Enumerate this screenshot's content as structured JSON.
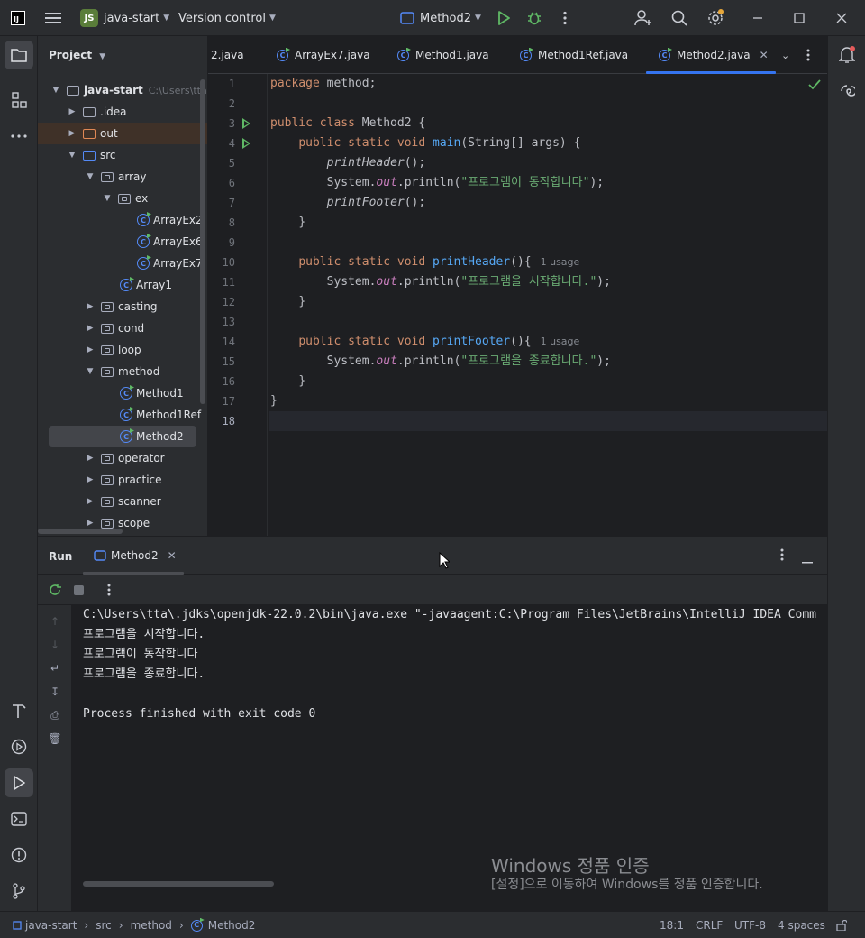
{
  "titlebar": {
    "project_name": "java-start",
    "project_badge": "JS",
    "vcs": "Version control",
    "run_config": "Method2"
  },
  "left_stripe": [
    "folder-icon",
    "structure-icon",
    "more-icon",
    "build-icon",
    "services-icon",
    "run-icon",
    "terminal-icon",
    "problems-icon",
    "git-icon"
  ],
  "right_stripe": [
    "notifications-icon",
    "ai-assistant-icon"
  ],
  "project_panel": {
    "title": "Project",
    "root": "java-start",
    "root_path": "C:\\Users\\tta",
    "tree": [
      {
        "label": ".idea",
        "type": "folder"
      },
      {
        "label": "out",
        "type": "out"
      },
      {
        "label": "src",
        "type": "src"
      },
      {
        "label": "array",
        "type": "pkg"
      },
      {
        "label": "ex",
        "type": "pkg"
      },
      {
        "label": "ArrayEx2",
        "type": "class"
      },
      {
        "label": "ArrayEx6",
        "type": "class"
      },
      {
        "label": "ArrayEx7",
        "type": "class"
      },
      {
        "label": "Array1",
        "type": "class"
      },
      {
        "label": "casting",
        "type": "pkg"
      },
      {
        "label": "cond",
        "type": "pkg"
      },
      {
        "label": "loop",
        "type": "pkg"
      },
      {
        "label": "method",
        "type": "pkg"
      },
      {
        "label": "Method1",
        "type": "class"
      },
      {
        "label": "Method1Ref",
        "type": "class"
      },
      {
        "label": "Method2",
        "type": "class"
      },
      {
        "label": "operator",
        "type": "pkg"
      },
      {
        "label": "practice",
        "type": "pkg"
      },
      {
        "label": "scanner",
        "type": "pkg"
      },
      {
        "label": "scope",
        "type": "pkg"
      }
    ]
  },
  "editor_tabs": [
    "2.java",
    "ArrayEx7.java",
    "Method1.java",
    "Method1Ref.java",
    "Method2.java"
  ],
  "code": {
    "line_numbers": [
      "1",
      "2",
      "3",
      "4",
      "5",
      "6",
      "7",
      "8",
      "9",
      "10",
      "11",
      "12",
      "13",
      "14",
      "15",
      "16",
      "17",
      "18"
    ],
    "l1_kw": "package",
    "l1_rest": " method;",
    "l3_kw": "public class",
    "l3_rest": " Method2 {",
    "l4_kw": "public static void",
    "l4_fn": "main",
    "l4_rest": "(String[] args) {",
    "l5_call": "printHeader",
    "l5_rest": "();",
    "l6_a": "System.",
    "l6_fld": "out",
    "l6_b": ".println(",
    "l6_str": "\"프로그램이 동작합니다\"",
    "l6_c": ");",
    "l7_call": "printFooter",
    "l7_rest": "();",
    "l8": "}",
    "l10_kw": "public static void",
    "l10_fn": "printHeader",
    "l10_rest": "(){",
    "l10_hint": "1 usage",
    "l11_a": "System.",
    "l11_fld": "out",
    "l11_b": ".println(",
    "l11_str": "\"프로그램을 시작합니다.\"",
    "l11_c": ");",
    "l12": "}",
    "l14_kw": "public static void",
    "l14_fn": "printFooter",
    "l14_rest": "(){",
    "l14_hint": "1 usage",
    "l15_a": "System.",
    "l15_fld": "out",
    "l15_b": ".println(",
    "l15_str": "\"프로그램을 종료합니다.\"",
    "l15_c": ");",
    "l16": "}",
    "l17": "}"
  },
  "run_panel": {
    "title": "Run",
    "tab": "Method2",
    "console": [
      "C:\\Users\\tta\\.jdks\\openjdk-22.0.2\\bin\\java.exe \"-javaagent:C:\\Program Files\\JetBrains\\IntelliJ IDEA Comm",
      "프로그램을 시작합니다.",
      "프로그램이 동작합니다",
      "프로그램을 종료합니다.",
      "",
      "Process finished with exit code 0"
    ]
  },
  "watermark": {
    "line1": "Windows 정품 인증",
    "line2": "[설정]으로 이동하여 Windows를 정품 인증합니다."
  },
  "statusbar": {
    "crumbs": [
      "java-start",
      "src",
      "method",
      "Method2"
    ],
    "position": "18:1",
    "line_sep": "CRLF",
    "encoding": "UTF-8",
    "indent": "4 spaces"
  }
}
